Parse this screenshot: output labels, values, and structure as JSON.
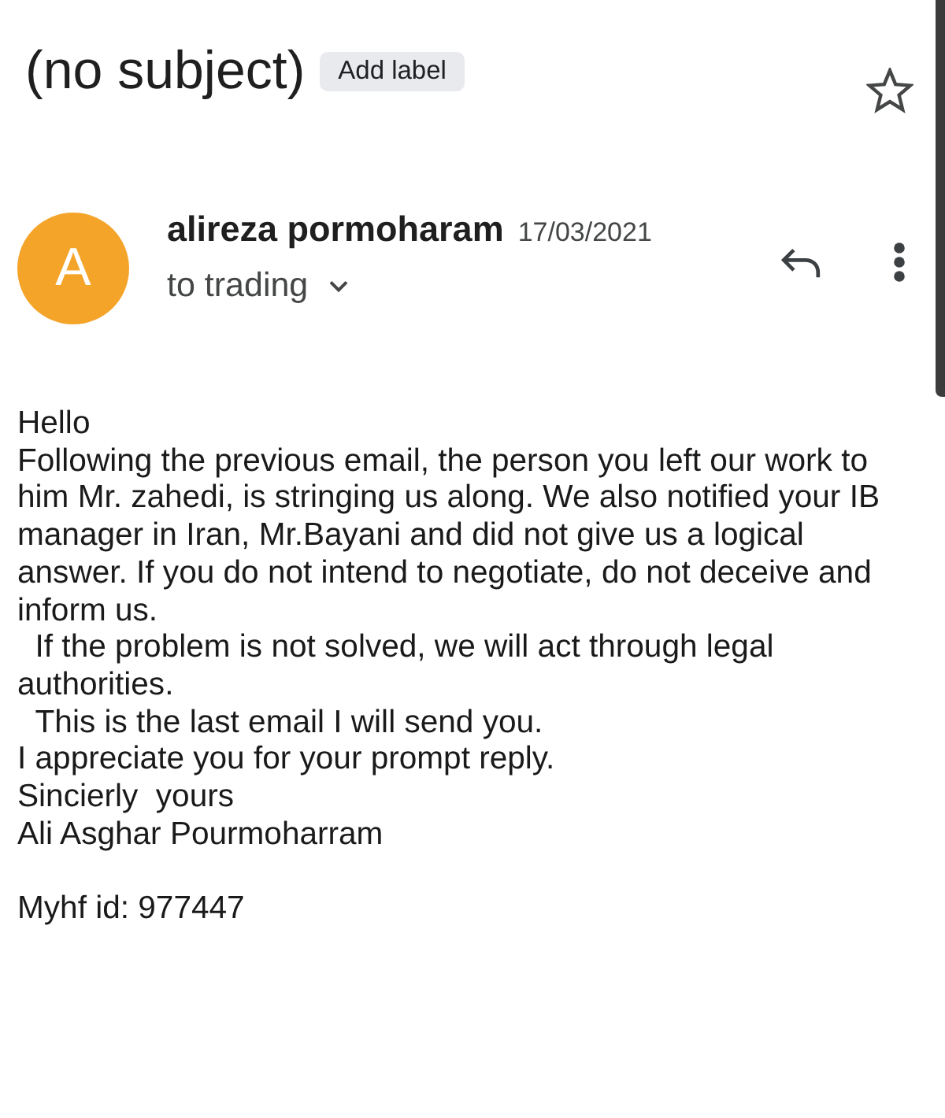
{
  "subject": {
    "title": "(no subject)",
    "label_button": "Add label",
    "starred": false
  },
  "message": {
    "avatar_letter": "A",
    "sender": "alireza pormoharam",
    "date": "17/03/2021",
    "recipients": "to trading"
  },
  "body": {
    "paragraphs": [
      [
        "Hello",
        "Following the previous email, the person you left our work to him Mr. zahedi, is stringing us along. We also notified your IB manager in Iran, Mr.Bayani and did not give us a logical answer. If you do not intend to negotiate, do not deceive and inform us.",
        "  If the problem is not solved, we will act through legal authorities.",
        "  This is the last email I will send you.",
        "I appreciate you for your prompt reply.",
        "Sincierly  yours",
        "Ali Asghar Pourmoharram"
      ],
      [
        "Myhf id: 977447"
      ]
    ]
  }
}
